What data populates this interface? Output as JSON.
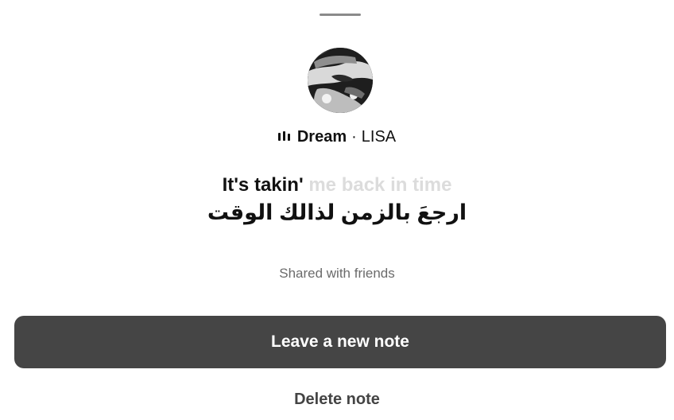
{
  "now_playing": {
    "title": "Dream",
    "separator": "·",
    "artist": "LISA",
    "playing_icon": "equalizer-bars-icon"
  },
  "lyrics": {
    "sung": "It's takin'",
    "upcoming": "me back in time",
    "translation": "ارجعَ بالزمن لذالك الوقت"
  },
  "note": {
    "audience": "Shared with friends"
  },
  "actions": {
    "primary_label": "Leave a new note",
    "secondary_label": "Delete note"
  },
  "colors": {
    "primary_button": "#454545",
    "upcoming_lyric": "#dcdcdc",
    "muted_text": "#6b6b6b"
  }
}
